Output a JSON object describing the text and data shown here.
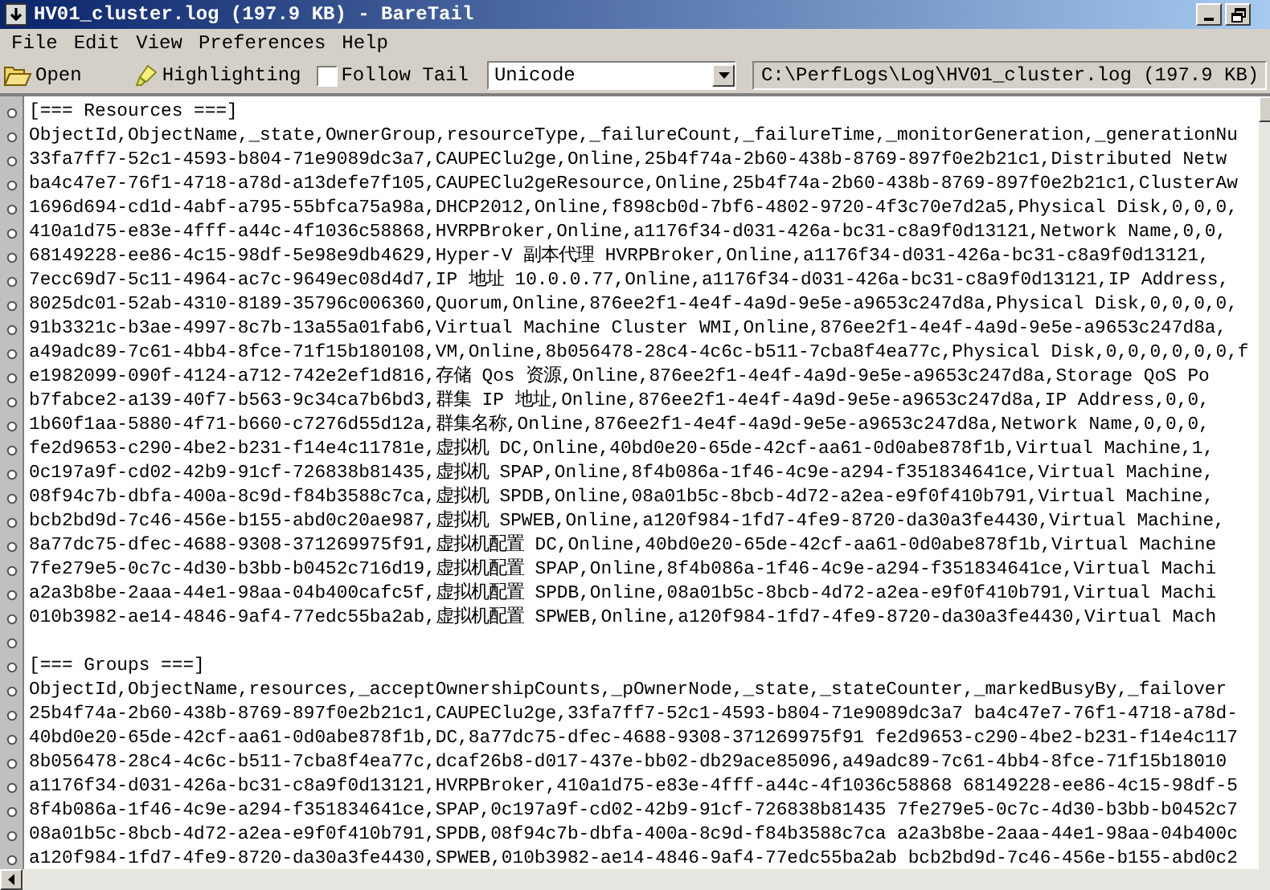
{
  "window": {
    "title": "HV01_cluster.log (197.9 KB) - BareTail"
  },
  "menu": [
    "File",
    "Edit",
    "View",
    "Preferences",
    "Help"
  ],
  "toolbar": {
    "open_button": "Open",
    "highlighting_button": "Highlighting",
    "follow_tail": {
      "label": "Follow Tail",
      "checked": false
    },
    "encoding": {
      "value": "Unicode"
    },
    "file_path": "C:\\PerfLogs\\Log\\HV01_cluster.log (197.9 KB)"
  },
  "log": {
    "lines": [
      {
        "kind": "text",
        "text": "[=== Resources ===]"
      },
      {
        "kind": "text",
        "text": "ObjectId,ObjectName,_state,OwnerGroup,resourceType,_failureCount,_failureTime,_monitorGeneration,_generationNu"
      },
      {
        "kind": "text",
        "text": "33fa7ff7-52c1-4593-b804-71e9089dc3a7,CAUPEClu2ge,Online,25b4f74a-2b60-438b-8769-897f0e2b21c1,Distributed Netw"
      },
      {
        "kind": "text",
        "text": "ba4c47e7-76f1-4718-a78d-a13defe7f105,CAUPEClu2geResource,Online,25b4f74a-2b60-438b-8769-897f0e2b21c1,ClusterAw"
      },
      {
        "kind": "text",
        "text": "1696d694-cd1d-4abf-a795-55bfca75a98a,DHCP2012,Online,f898cb0d-7bf6-4802-9720-4f3c70e7d2a5,Physical Disk,0,0,0,"
      },
      {
        "kind": "text",
        "text": "410a1d75-e83e-4fff-a44c-4f1036c58868,HVRPBroker,Online,a1176f34-d031-426a-bc31-c8a9f0d13121,Network Name,0,0,"
      },
      {
        "kind": "text",
        "text": "68149228-ee86-4c15-98df-5e98e9db4629,Hyper-V 副本代理 HVRPBroker,Online,a1176f34-d031-426a-bc31-c8a9f0d13121,"
      },
      {
        "kind": "text",
        "text": "7ecc69d7-5c11-4964-ac7c-9649ec08d4d7,IP 地址 10.0.0.77,Online,a1176f34-d031-426a-bc31-c8a9f0d13121,IP Address,"
      },
      {
        "kind": "text",
        "text": "8025dc01-52ab-4310-8189-35796c006360,Quorum,Online,876ee2f1-4e4f-4a9d-9e5e-a9653c247d8a,Physical Disk,0,0,0,0,"
      },
      {
        "kind": "text",
        "text": "91b3321c-b3ae-4997-8c7b-13a55a01fab6,Virtual Machine Cluster WMI,Online,876ee2f1-4e4f-4a9d-9e5e-a9653c247d8a,"
      },
      {
        "kind": "text",
        "text": "a49adc89-7c61-4bb4-8fce-71f15b180108,VM,Online,8b056478-28c4-4c6c-b511-7cba8f4ea77c,Physical Disk,0,0,0,0,0,0,f"
      },
      {
        "kind": "text",
        "text": "e1982099-090f-4124-a712-742e2ef1d816,存储 Qos 资源,Online,876ee2f1-4e4f-4a9d-9e5e-a9653c247d8a,Storage QoS Po"
      },
      {
        "kind": "text",
        "text": "b7fabce2-a139-40f7-b563-9c34ca7b6bd3,群集 IP 地址,Online,876ee2f1-4e4f-4a9d-9e5e-a9653c247d8a,IP Address,0,0,"
      },
      {
        "kind": "text",
        "text": "1b60f1aa-5880-4f71-b660-c7276d55d12a,群集名称,Online,876ee2f1-4e4f-4a9d-9e5e-a9653c247d8a,Network Name,0,0,0,"
      },
      {
        "kind": "text",
        "text": "fe2d9653-c290-4be2-b231-f14e4c11781e,虚拟机 DC,Online,40bd0e20-65de-42cf-aa61-0d0abe878f1b,Virtual Machine,1,"
      },
      {
        "kind": "text",
        "text": "0c197a9f-cd02-42b9-91cf-726838b81435,虚拟机 SPAP,Online,8f4b086a-1f46-4c9e-a294-f351834641ce,Virtual Machine,"
      },
      {
        "kind": "text",
        "text": "08f94c7b-dbfa-400a-8c9d-f84b3588c7ca,虚拟机 SPDB,Online,08a01b5c-8bcb-4d72-a2ea-e9f0f410b791,Virtual Machine,"
      },
      {
        "kind": "text",
        "text": "bcb2bd9d-7c46-456e-b155-abd0c20ae987,虚拟机 SPWEB,Online,a120f984-1fd7-4fe9-8720-da30a3fe4430,Virtual Machine,"
      },
      {
        "kind": "text",
        "text": "8a77dc75-dfec-4688-9308-371269975f91,虚拟机配置 DC,Online,40bd0e20-65de-42cf-aa61-0d0abe878f1b,Virtual Machine"
      },
      {
        "kind": "text",
        "text": "7fe279e5-0c7c-4d30-b3bb-b0452c716d19,虚拟机配置 SPAP,Online,8f4b086a-1f46-4c9e-a294-f351834641ce,Virtual Machi"
      },
      {
        "kind": "text",
        "text": "a2a3b8be-2aaa-44e1-98aa-04b400cafc5f,虚拟机配置 SPDB,Online,08a01b5c-8bcb-4d72-a2ea-e9f0f410b791,Virtual Machi"
      },
      {
        "kind": "text",
        "text": "010b3982-ae14-4846-9af4-77edc55ba2ab,虚拟机配置 SPWEB,Online,a120f984-1fd7-4fe9-8720-da30a3fe4430,Virtual Mach"
      },
      {
        "kind": "blank"
      },
      {
        "kind": "text",
        "text": "[=== Groups ===]"
      },
      {
        "kind": "text",
        "text": "ObjectId,ObjectName,resources,_acceptOwnershipCounts,_pOwnerNode,_state,_stateCounter,_markedBusyBy,_failover"
      },
      {
        "kind": "text",
        "text": "25b4f74a-2b60-438b-8769-897f0e2b21c1,CAUPEClu2ge,33fa7ff7-52c1-4593-b804-71e9089dc3a7 ba4c47e7-76f1-4718-a78d-"
      },
      {
        "kind": "text",
        "text": "40bd0e20-65de-42cf-aa61-0d0abe878f1b,DC,8a77dc75-dfec-4688-9308-371269975f91 fe2d9653-c290-4be2-b231-f14e4c117"
      },
      {
        "kind": "text",
        "text": "8b056478-28c4-4c6c-b511-7cba8f4ea77c,dcaf26b8-d017-437e-bb02-db29ace85096,a49adc89-7c61-4bb4-8fce-71f15b18010"
      },
      {
        "kind": "text",
        "text": "a1176f34-d031-426a-bc31-c8a9f0d13121,HVRPBroker,410a1d75-e83e-4fff-a44c-4f1036c58868 68149228-ee86-4c15-98df-5"
      },
      {
        "kind": "text",
        "text": "8f4b086a-1f46-4c9e-a294-f351834641ce,SPAP,0c197a9f-cd02-42b9-91cf-726838b81435 7fe279e5-0c7c-4d30-b3bb-b0452c7"
      },
      {
        "kind": "text",
        "text": "08a01b5c-8bcb-4d72-a2ea-e9f0f410b791,SPDB,08f94c7b-dbfa-400a-8c9d-f84b3588c7ca a2a3b8be-2aaa-44e1-98aa-04b400c"
      },
      {
        "kind": "text",
        "text": "a120f984-1fd7-4fe9-8720-da30a3fe4430,SPWEB,010b3982-ae14-4846-9af4-77edc55ba2ab bcb2bd9d-7c46-456e-b155-abd0c2"
      }
    ]
  }
}
